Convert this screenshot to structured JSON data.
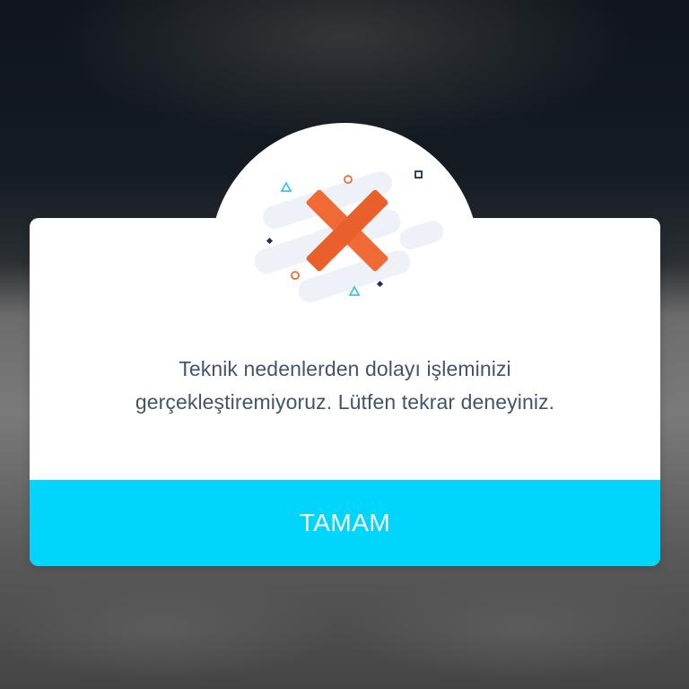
{
  "dialog": {
    "icon": "error-x-icon",
    "message_line1": "Teknik nedenlerden dolayı işleminizi",
    "message_line2": "gerçekleştiremiyoruz. Lütfen tekrar deneyiniz.",
    "ok_label": "TAMAM"
  },
  "colors": {
    "accent_button": "#00d6fb",
    "error_x": "#f06a35",
    "message_text": "#44546a",
    "decor_cyan": "#3ec6e0",
    "decor_orange": "#f06a35",
    "decor_navy": "#1e3354",
    "decor_cloud": "#eef2f8"
  }
}
